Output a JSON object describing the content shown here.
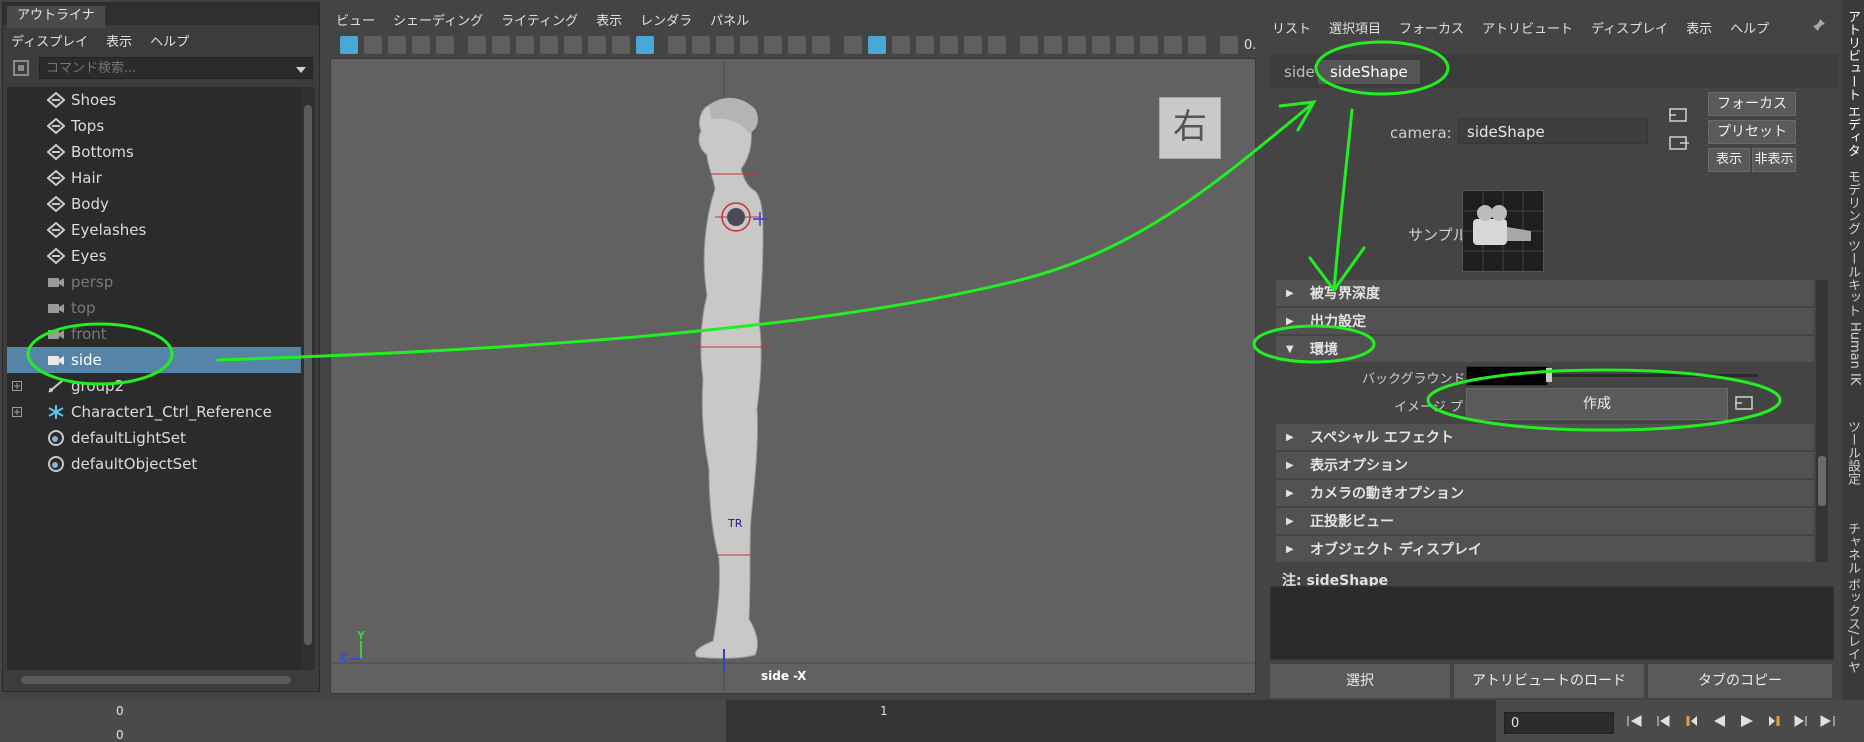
{
  "outliner": {
    "tab_title": "アウトライナ",
    "menus": [
      "ディスプレイ",
      "表示",
      "ヘルプ"
    ],
    "search_placeholder": "コマンド検索...",
    "items": [
      {
        "label": "Shoes",
        "icon": "mesh-icon",
        "state": "normal"
      },
      {
        "label": "Tops",
        "icon": "mesh-icon",
        "state": "normal"
      },
      {
        "label": "Bottoms",
        "icon": "mesh-icon",
        "state": "normal"
      },
      {
        "label": "Hair",
        "icon": "mesh-icon",
        "state": "normal"
      },
      {
        "label": "Body",
        "icon": "mesh-icon",
        "state": "normal"
      },
      {
        "label": "Eyelashes",
        "icon": "mesh-icon",
        "state": "normal"
      },
      {
        "label": "Eyes",
        "icon": "mesh-icon",
        "state": "normal"
      },
      {
        "label": "persp",
        "icon": "camera-icon",
        "state": "dim"
      },
      {
        "label": "top",
        "icon": "camera-icon",
        "state": "dim"
      },
      {
        "label": "front",
        "icon": "camera-icon",
        "state": "dim"
      },
      {
        "label": "side",
        "icon": "camera-icon",
        "state": "selected"
      },
      {
        "label": "group2",
        "icon": "group-icon",
        "state": "normal"
      },
      {
        "label": "Character1_Ctrl_Reference",
        "icon": "joint-icon",
        "state": "normal"
      },
      {
        "label": "defaultLightSet",
        "icon": "set-icon",
        "state": "normal"
      },
      {
        "label": "defaultObjectSet",
        "icon": "set-icon",
        "state": "normal"
      }
    ]
  },
  "viewport": {
    "menus": [
      "ビュー",
      "シェーディング",
      "ライティング",
      "表示",
      "レンダラ",
      "パネル"
    ],
    "toolbar_value": "0.",
    "view_label": "side -X",
    "view_badge": "右",
    "root_marker": "TR",
    "axis_y": "Y",
    "axis_z": "Z"
  },
  "attribute_editor": {
    "menus": [
      "リスト",
      "選択項目",
      "フォーカス",
      "アトリビュート",
      "ディスプレイ",
      "表示",
      "ヘルプ"
    ],
    "tabs": [
      "side",
      "sideShape"
    ],
    "active_tab": "sideShape",
    "camera_label": "camera:",
    "camera_value": "sideShape",
    "buttons": {
      "focus": "フォーカス",
      "preset": "プリセット",
      "show": "表示",
      "hide": "非表示"
    },
    "sample_label": "サンプル",
    "sections": [
      {
        "label": "被写界深度",
        "expanded": false
      },
      {
        "label": "出力設定",
        "expanded": false
      },
      {
        "label": "環境",
        "expanded": true
      },
      {
        "label": "スペシャル エフェクト",
        "expanded": false
      },
      {
        "label": "表示オプション",
        "expanded": false
      },
      {
        "label": "カメラの動きオプション",
        "expanded": false
      },
      {
        "label": "正投影ビュー",
        "expanded": false
      },
      {
        "label": "オブジェクト ディスプレイ",
        "expanded": false
      }
    ],
    "bg_color_label": "バックグラウンド カラー",
    "bg_color_value": "#000000",
    "image_plane_label": "イメージ プレーン",
    "create_button": "作成",
    "note_label": "注:",
    "note_value": "sideShape",
    "bottom_buttons": [
      "選択",
      "アトリビュートのロード",
      "タブのコピー"
    ]
  },
  "side_tabs": [
    "アトリビュート エディタ",
    "モデリング ツールキット",
    "Human IK",
    "ツール設定",
    "チャネル ボックス/レイヤ"
  ],
  "timeline": {
    "start": "0",
    "tick": "1",
    "below": "0",
    "current_time": "0"
  },
  "annotation_color": "#22ee22"
}
